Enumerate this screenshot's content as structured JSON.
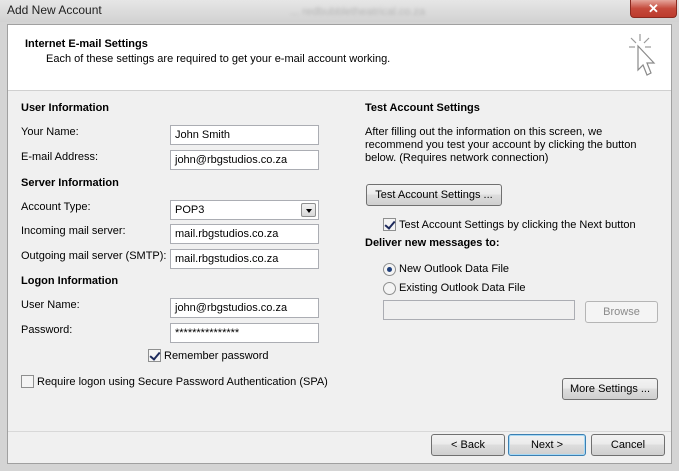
{
  "window": {
    "title": "Add New Account",
    "background_blur_text": "... redbubbletheatrical.co.za",
    "close_glyph": "✕"
  },
  "header": {
    "title": "Internet E-mail Settings",
    "subtitle": "Each of these settings are required to get your e-mail account working.",
    "icon": "cursor-sparkle-icon"
  },
  "user_info": {
    "heading": "User Information",
    "name_label": "Your Name:",
    "name_value": "John Smith",
    "email_label": "E-mail Address:",
    "email_value": "john@rbgstudios.co.za"
  },
  "server_info": {
    "heading": "Server Information",
    "account_type_label": "Account Type:",
    "account_type_value": "POP3",
    "incoming_label": "Incoming mail server:",
    "incoming_value": "mail.rbgstudios.co.za",
    "outgoing_label": "Outgoing mail server (SMTP):",
    "outgoing_value": "mail.rbgstudios.co.za"
  },
  "logon_info": {
    "heading": "Logon Information",
    "username_label": "User Name:",
    "username_value": "john@rbgstudios.co.za",
    "password_label": "Password:",
    "password_value": "***************",
    "remember_label": "Remember password",
    "remember_checked": true,
    "spa_label": "Require logon using Secure Password Authentication (SPA)",
    "spa_checked": false
  },
  "test_settings": {
    "heading": "Test Account Settings",
    "description_line1": "After filling out the information on this screen, we",
    "description_line2": "recommend you test your account by clicking the button",
    "description_line3": "below. (Requires network connection)",
    "test_button": "Test Account Settings ...",
    "test_next_label": "Test Account Settings by clicking the Next button",
    "test_next_checked": true
  },
  "deliver": {
    "heading": "Deliver new messages to:",
    "new_file_label": "New Outlook Data File",
    "existing_file_label": "Existing Outlook Data File",
    "selected": "new",
    "existing_path_value": "",
    "browse_button": "Browse"
  },
  "more_settings_button": "More Settings ...",
  "footer": {
    "back_button": "< Back",
    "next_button": "Next >",
    "cancel_button": "Cancel"
  }
}
